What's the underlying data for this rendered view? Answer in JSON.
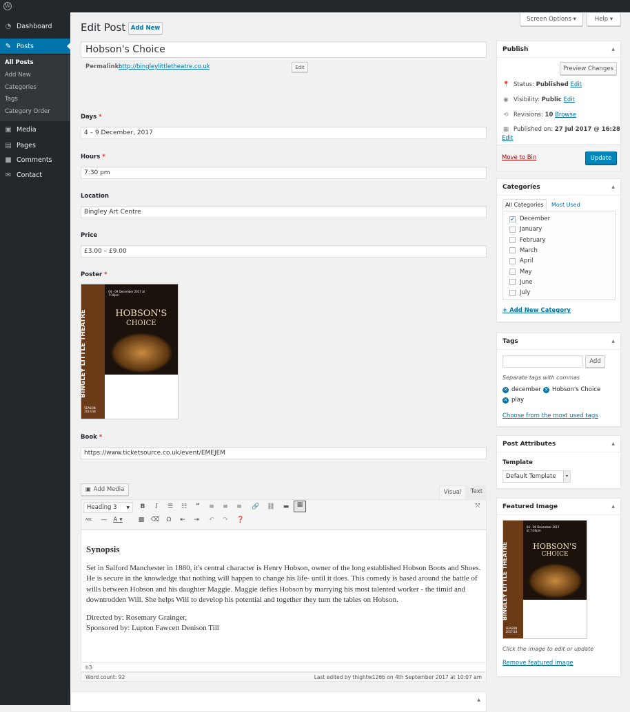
{
  "admin_bar": {
    "screen_options": "Screen Options ▾",
    "help": "Help ▾"
  },
  "sidebar": {
    "items": [
      {
        "label": "Dashboard",
        "icon": "dashboard-icon"
      },
      {
        "label": "Posts",
        "icon": "pin-icon"
      },
      {
        "label": "Media",
        "icon": "media-icon"
      },
      {
        "label": "Pages",
        "icon": "pages-icon"
      },
      {
        "label": "Comments",
        "icon": "comment-icon"
      },
      {
        "label": "Contact",
        "icon": "mail-icon"
      }
    ],
    "submenu": [
      "All Posts",
      "Add New",
      "Categories",
      "Tags",
      "Category Order"
    ]
  },
  "page": {
    "title": "Edit Post",
    "add_new": "Add New"
  },
  "post": {
    "title": "Hobson's Choice",
    "permalink_label": "Permalink:",
    "permalink_url": "http://bingleylittletheatre.co.uk/",
    "permalink_edit": "Edit"
  },
  "fields": {
    "days": {
      "label": "Days",
      "value": "4 – 9 December, 2017"
    },
    "hours": {
      "label": "Hours",
      "value": "7:30 pm"
    },
    "location": {
      "label": "Location",
      "value": "Bingley Art Centre"
    },
    "price": {
      "label": "Price",
      "value": "£3.00 – £9.00"
    },
    "poster": {
      "label": "Poster"
    },
    "book": {
      "label": "Book",
      "value": "https://www.ticketsource.co.uk/event/EMEJEM"
    },
    "required_mark": "*"
  },
  "poster_art": {
    "theatre": "BINGLEY LITTLE THEATRE",
    "title_1": "HOBSON'S",
    "title_2": "CHOICE",
    "date": "04 - 09 December 2017 at 7:30pm",
    "season": "SEASON 2017/18"
  },
  "editor": {
    "add_media": "Add Media",
    "tab_visual": "Visual",
    "tab_text": "Text",
    "format_select": "Heading 3",
    "heading": "Synopsis",
    "paragraph": "Set in Salford Manchester in 1880, it's central character is Henry Hobson, owner of the long established Hobson Boots and Shoes. He is secure in the knowledge that nothing will happen to change his life- until it does. This comedy is based around the battle of wills between Hobson and his daughter Maggie. Maggie defies Hobson by marrying his most talented worker - the timid and downtrodden Will. She helps Will to develop his potential and together they turn the tables on Hobson.",
    "directed": "Directed by: Rosemary Grainger,",
    "sponsored": "Sponsored by: Lupton Fawcett Denison Till",
    "path": "h3",
    "word_count": "Word count: 92",
    "last_edited": "Last edited by thightw126b on 4th September 2017 at 10:07 am"
  },
  "publish": {
    "title": "Publish",
    "preview": "Preview Changes",
    "status_label": "Status:",
    "status": "Published",
    "visibility_label": "Visibility:",
    "visibility": "Public",
    "revisions_label": "Revisions:",
    "revisions": "10",
    "browse": "Browse",
    "published_label": "Published on:",
    "published": "27 Jul 2017 @ 16:28",
    "edit": "Edit",
    "move_to_bin": "Move to Bin",
    "update": "Update"
  },
  "categories": {
    "title": "Categories",
    "tab_all": "All Categories",
    "tab_most": "Most Used",
    "items": [
      {
        "label": "December",
        "checked": true
      },
      {
        "label": "January",
        "checked": false
      },
      {
        "label": "February",
        "checked": false
      },
      {
        "label": "March",
        "checked": false
      },
      {
        "label": "April",
        "checked": false
      },
      {
        "label": "May",
        "checked": false
      },
      {
        "label": "June",
        "checked": false
      },
      {
        "label": "July",
        "checked": false
      }
    ],
    "add_new": "+ Add New Category"
  },
  "tags": {
    "title": "Tags",
    "add": "Add",
    "hint": "Separate tags with commas",
    "items": [
      "december",
      "Hobson's Choice",
      "play"
    ],
    "choose": "Choose from the most used tags"
  },
  "attributes": {
    "title": "Post Attributes",
    "template_label": "Template",
    "template": "Default Template"
  },
  "featured": {
    "title": "Featured Image",
    "hint": "Click the image to edit or update",
    "remove": "Remove featured image"
  },
  "colors": {
    "accent": "#0073aa",
    "sidebar": "#23282d",
    "danger": "#a00"
  }
}
